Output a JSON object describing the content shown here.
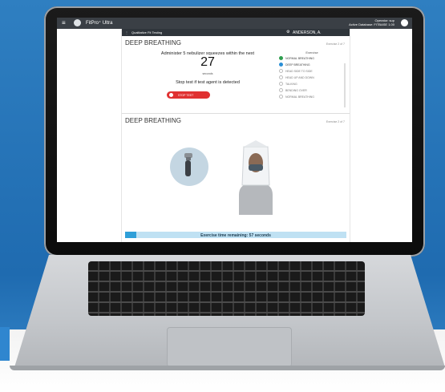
{
  "app": {
    "title": "FitPro⁺ Ultra",
    "operator_line1": "Operator: sup",
    "operator_line2": "Active Database: FITBASE 1.00"
  },
  "panel": {
    "header": "Qualitative Fit Testing",
    "person": "ANDERSON, A."
  },
  "section1": {
    "title": "DEEP BREATHING",
    "exercise_of": "Exercise 2 of 7",
    "instruction": "Administer 5 nebulizer squeezes within the next",
    "countdown": "27",
    "countdown_unit": "seconds",
    "stop_message": "Stop test if test agent is detected",
    "stop_button": "STOP TEST"
  },
  "exercises": {
    "heading": "Exercise",
    "items": [
      {
        "label": "NORMAL BREATHING",
        "state": "done"
      },
      {
        "label": "DEEP BREATHING",
        "state": "current"
      },
      {
        "label": "HEAD SIDE TO SIDE",
        "state": "pending"
      },
      {
        "label": "HEAD UP AND DOWN",
        "state": "pending"
      },
      {
        "label": "TALKING",
        "state": "pending"
      },
      {
        "label": "BENDING OVER",
        "state": "pending"
      },
      {
        "label": "NORMAL BREATHING",
        "state": "pending"
      }
    ]
  },
  "section2": {
    "title": "DEEP BREATHING",
    "exercise_of": "Exercise 2 of 7"
  },
  "progress": {
    "label": "Exercise time remaining: 57 seconds",
    "fraction": 0.05
  },
  "colors": {
    "accent": "#2f9fd8",
    "stop": "#e03131",
    "done": "#2e9e4f",
    "current": "#2a8fd6"
  }
}
